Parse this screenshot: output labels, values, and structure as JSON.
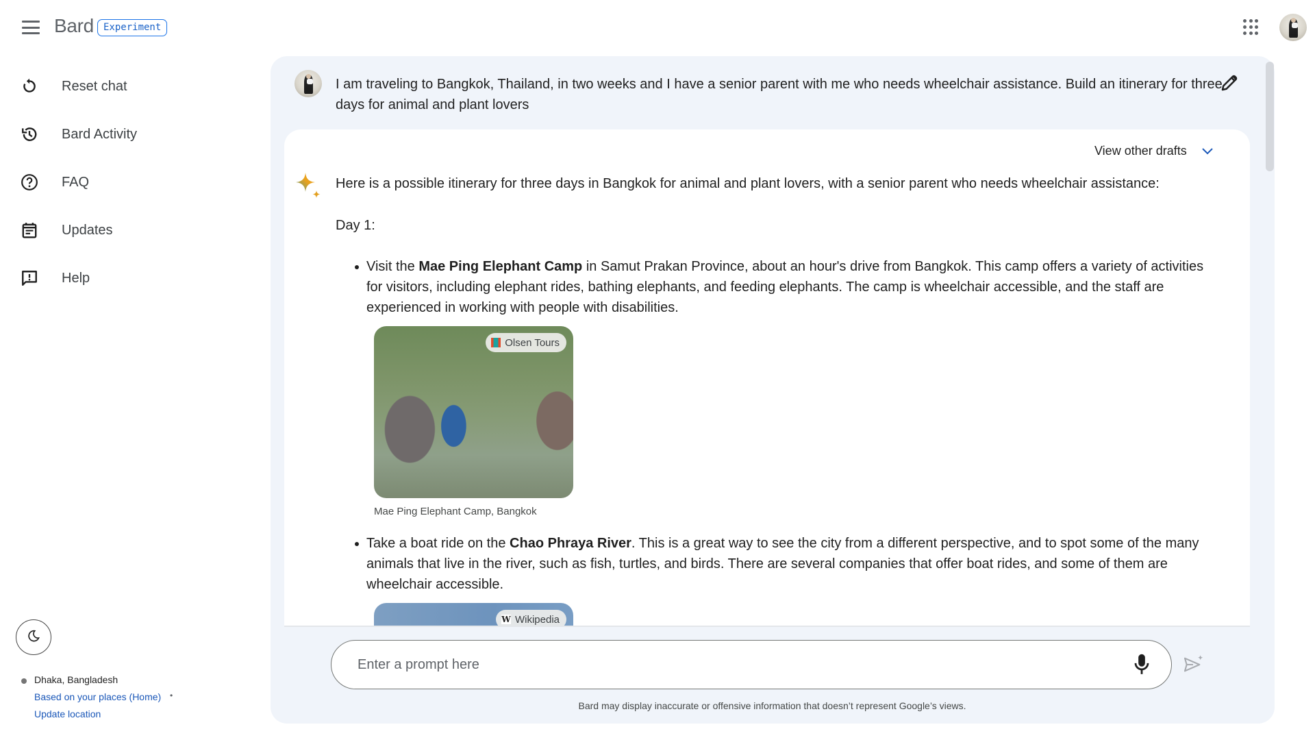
{
  "header": {
    "app_name": "Bard",
    "badge": "Experiment",
    "menu_icon": "hamburger-menu-icon",
    "apps_icon": "google-apps-grid-icon",
    "account_icon": "account-avatar"
  },
  "sidebar": {
    "items": [
      {
        "label": "Reset chat",
        "icon": "reset-icon"
      },
      {
        "label": "Bard Activity",
        "icon": "history-icon"
      },
      {
        "label": "FAQ",
        "icon": "help-circle-icon"
      },
      {
        "label": "Updates",
        "icon": "calendar-icon"
      },
      {
        "label": "Help",
        "icon": "feedback-icon"
      }
    ],
    "theme_toggle_icon": "moon-icon",
    "location": {
      "name": "Dhaka, Bangladesh",
      "source_link": "Based on your places (Home)",
      "separator": "•",
      "update_link": "Update location"
    }
  },
  "conversation": {
    "prompt": "I am traveling to Bangkok, Thailand, in two weeks and I have a senior parent with me who needs wheelchair assistance. Build an itinerary for three days for animal and plant lovers",
    "edit_icon": "pencil-icon",
    "view_drafts_label": "View other drafts",
    "response": {
      "intro": "Here is a possible itinerary for three days in Bangkok for animal and plant lovers, with a senior parent who needs wheelchair assistance:",
      "day_label": "Day 1:",
      "bullets": [
        {
          "pre": "Visit the ",
          "bold": "Mae Ping Elephant Camp",
          "post": " in Samut Prakan Province, about an hour's drive from Bangkok. This camp offers a variety of activities for visitors, including elephant rides, bathing elephants, and feeding elephants. The camp is wheelchair accessible, and the staff are experienced in working with people with disabilities.",
          "image": {
            "source": "Olsen Tours",
            "caption": "Mae Ping Elephant Camp, Bangkok",
            "alt": "Elephants bathing in a river with a handler"
          }
        },
        {
          "pre": "Take a boat ride on the ",
          "bold": "Chao Phraya River",
          "post": ". This is a great way to see the city from a different perspective, and to spot some of the many animals that live in the river, such as fish, turtles, and birds. There are several companies that offer boat rides, and some of them are wheelchair accessible.",
          "image": {
            "source": "Wikipedia"
          }
        }
      ]
    }
  },
  "input": {
    "placeholder": "Enter a prompt here",
    "value": "",
    "mic_icon": "microphone-icon",
    "send_icon": "send-icon"
  },
  "disclaimer": "Bard may display inaccurate or offensive information that doesn’t represent Google’s views.",
  "colors": {
    "accent": "#1a73e8",
    "link": "#1a57b8",
    "panel_bg": "#f0f4fa",
    "text": "#1f1f1f"
  }
}
